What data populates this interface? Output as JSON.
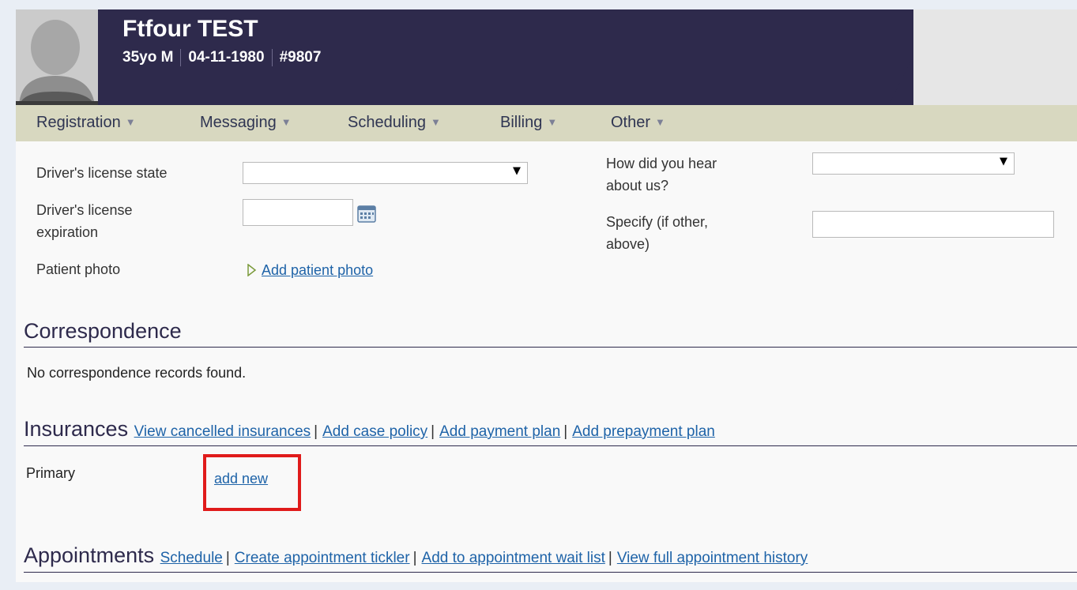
{
  "patient": {
    "name": "Ftfour TEST",
    "age_sex": "35yo M",
    "dob": "04-11-1980",
    "chart_id": "#9807"
  },
  "menu": [
    {
      "label": "Registration"
    },
    {
      "label": "Messaging"
    },
    {
      "label": "Scheduling"
    },
    {
      "label": "Billing"
    },
    {
      "label": "Other"
    }
  ],
  "form": {
    "dl_state_label": "Driver's license state",
    "dl_state_value": "",
    "dl_exp_label_1": "Driver's license",
    "dl_exp_label_2": "expiration",
    "dl_exp_value": "",
    "photo_label": "Patient photo",
    "add_photo_link": "Add patient photo",
    "hear_label_1": "How did you hear",
    "hear_label_2": "about us?",
    "hear_value": "",
    "specify_label_1": "Specify (if other,",
    "specify_label_2": "above)",
    "specify_value": ""
  },
  "correspondence": {
    "title": "Correspondence",
    "empty_text": "No correspondence records found."
  },
  "insurances": {
    "title": "Insurances",
    "links": [
      "View cancelled insurances",
      "Add case policy",
      "Add payment plan",
      "Add prepayment plan"
    ],
    "primary_label": "Primary",
    "add_new": "add new"
  },
  "appointments": {
    "title": "Appointments",
    "links": [
      "Schedule",
      "Create appointment tickler",
      "Add to appointment wait list",
      "View full appointment history"
    ]
  },
  "icons": {
    "caret": "caret-down-icon",
    "calendar": "calendar-icon",
    "photo_arrow": "play-outline-icon",
    "avatar": "person-silhouette-icon"
  }
}
